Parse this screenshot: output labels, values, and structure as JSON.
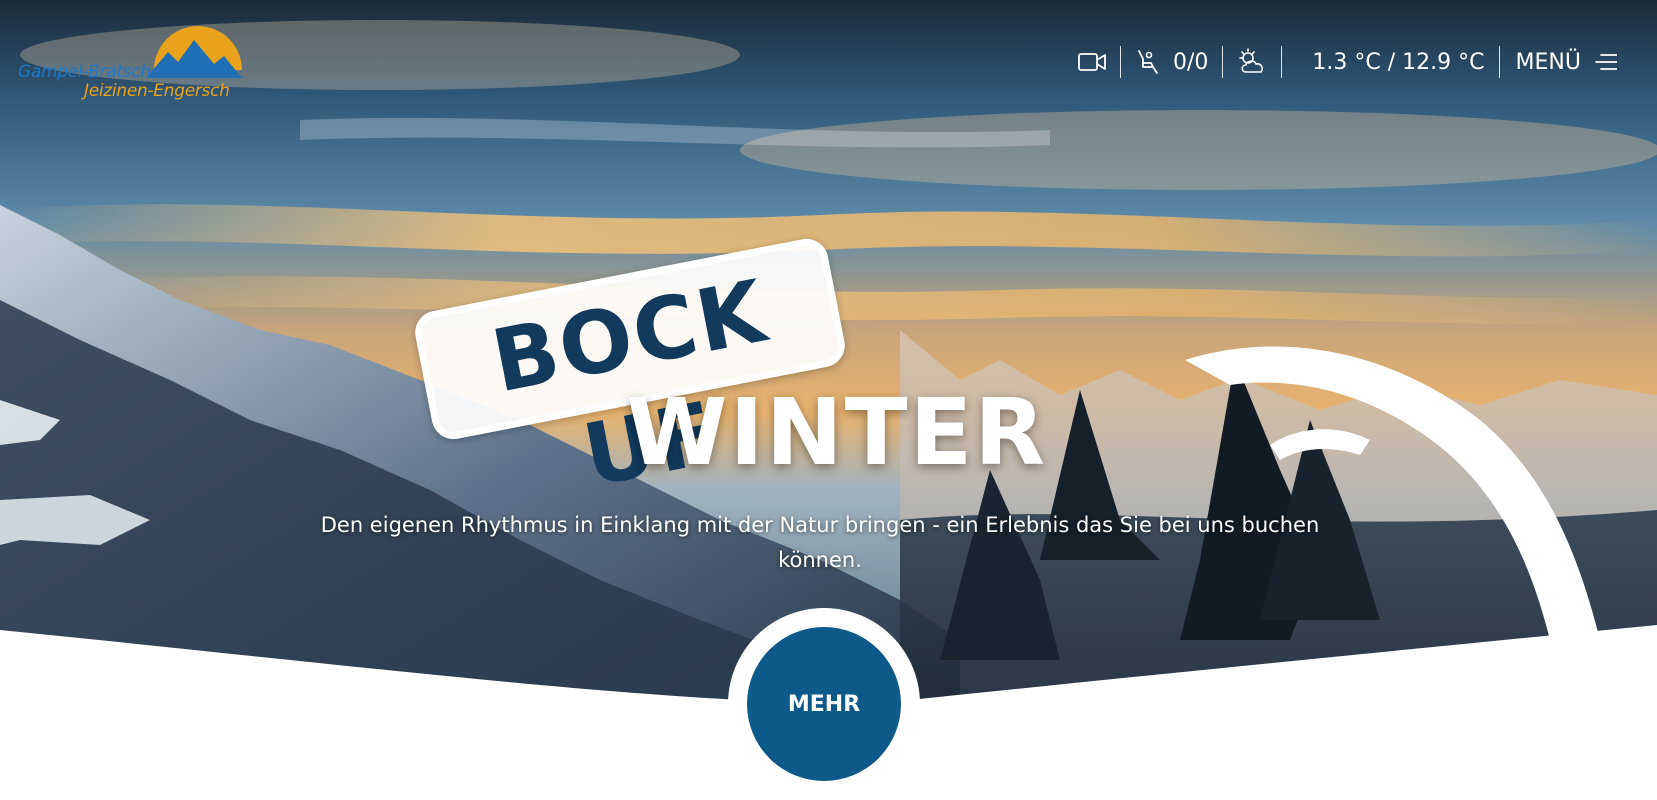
{
  "logo": {
    "line1": "Gampel-Bratsch",
    "line2": "Jeizinen-Engersch"
  },
  "topbar": {
    "webcam_icon": "video-camera-icon",
    "lifts_icon": "chairlift-icon",
    "lifts_status": "0/0",
    "weather_icon": "partly-cloudy-icon",
    "temperature": "1.3 °C / 12.9 °C",
    "menu_label": "MENÜ",
    "menu_icon": "hamburger-menu-icon"
  },
  "hero": {
    "stamp_text": "BOCK UF",
    "headline": "WINTER",
    "subtitle": "Den eigenen Rhythmus in Einklang mit der Natur bringen - ein Erlebnis das Sie bei uns buchen können.",
    "cta_label": "MEHR"
  },
  "colors": {
    "accent_blue": "#0d5a8a",
    "logo_blue": "#1f78c8",
    "logo_orange": "#e8a21c",
    "stamp_text": "#123a5c"
  }
}
